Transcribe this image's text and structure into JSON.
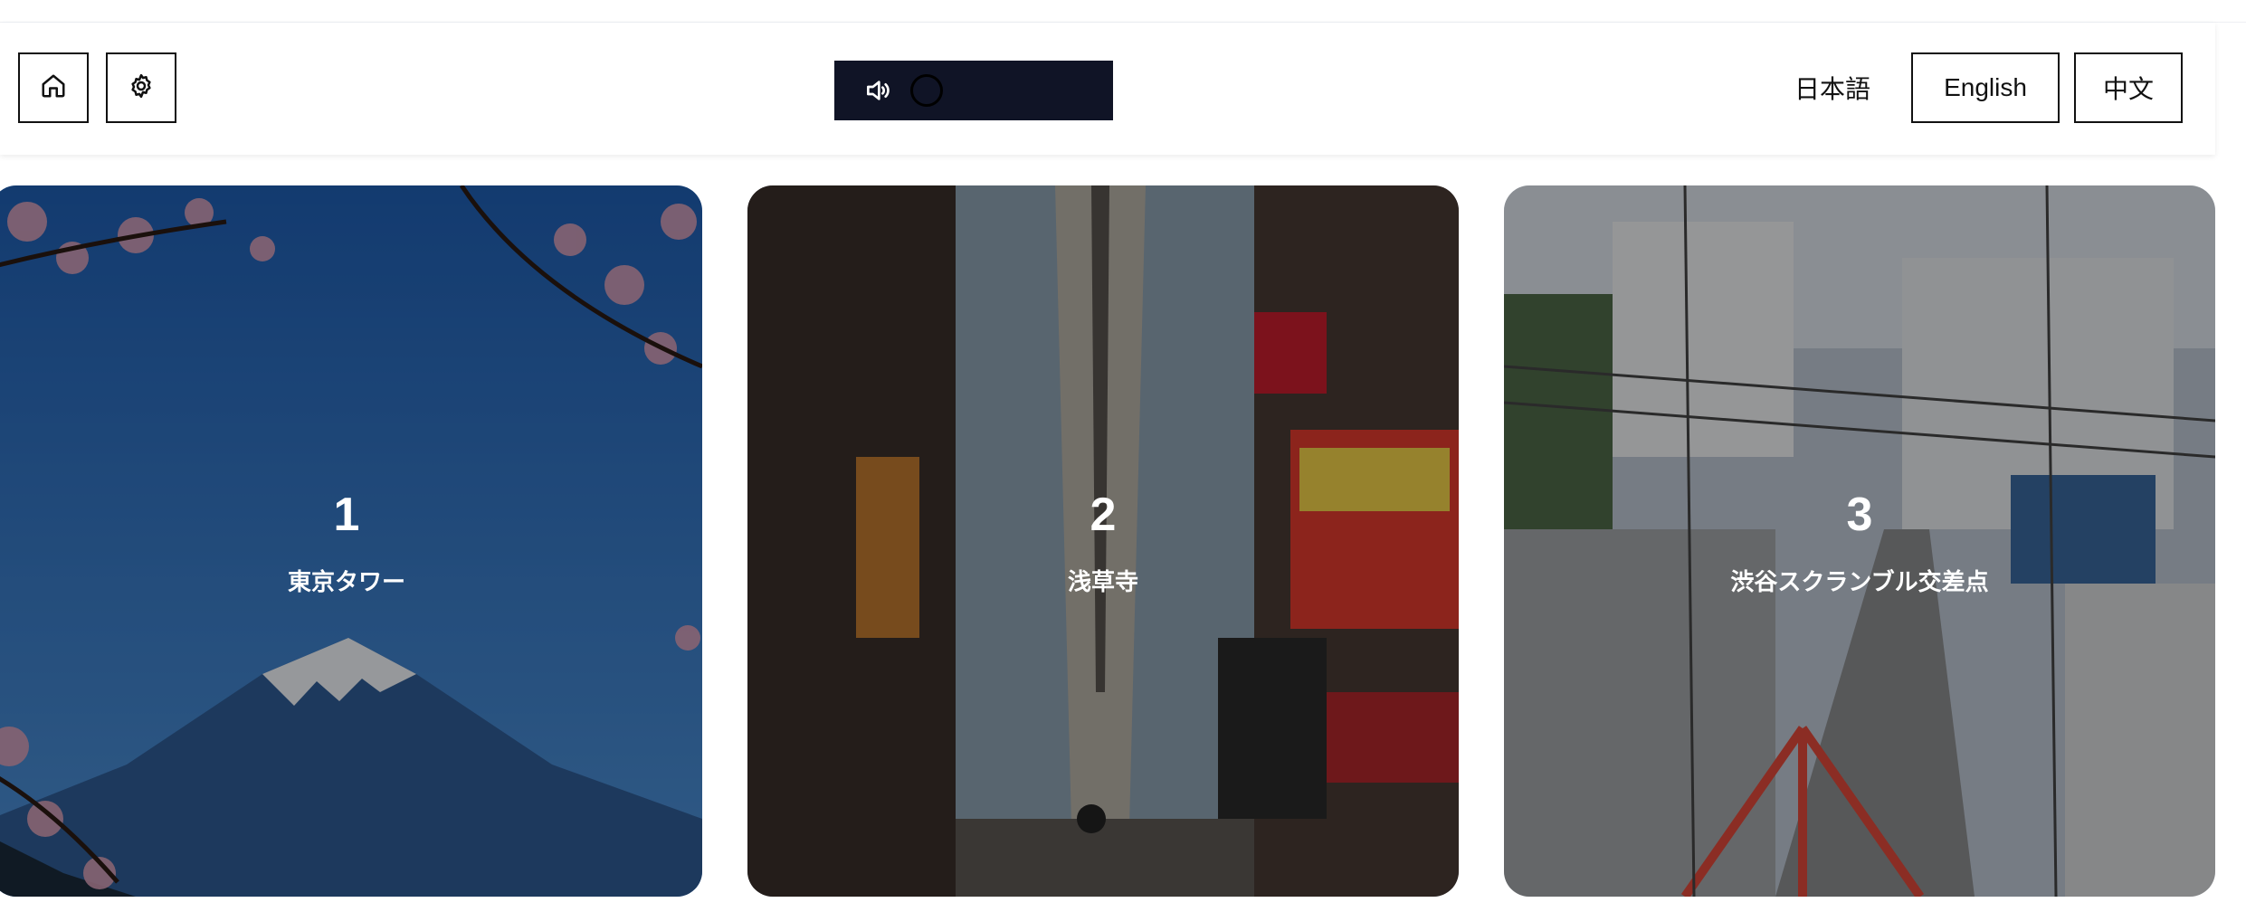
{
  "header": {
    "home_icon": "home-icon",
    "settings_icon": "gear-icon",
    "audio": {
      "speaker_icon": "speaker-icon",
      "background": "#101426"
    },
    "languages": [
      {
        "label": "日本語",
        "selected": false
      },
      {
        "label": "English",
        "selected": true
      },
      {
        "label": "中文",
        "selected": true
      }
    ]
  },
  "cards": [
    {
      "number": "1",
      "title": "東京タワー"
    },
    {
      "number": "2",
      "title": "浅草寺"
    },
    {
      "number": "3",
      "title": "渋谷スクランブル交差点"
    }
  ]
}
